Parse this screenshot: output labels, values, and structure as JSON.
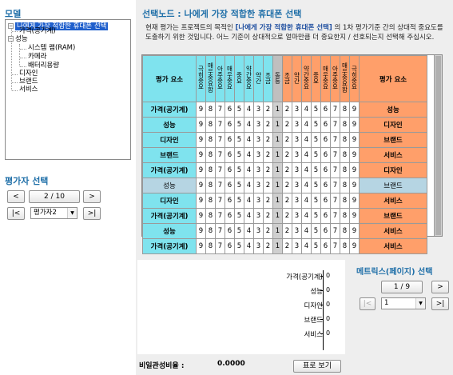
{
  "model": {
    "title": "모델",
    "tree": [
      {
        "label": "나에게 가장 적합한 휴대폰 선택",
        "selected": true
      },
      {
        "label": "가격(공기계)"
      },
      {
        "label": "성능"
      },
      {
        "label": "시스템 램(RAM)"
      },
      {
        "label": "카메라"
      },
      {
        "label": "배터리용량"
      },
      {
        "label": "디자인"
      },
      {
        "label": "브랜드"
      },
      {
        "label": "서비스"
      }
    ]
  },
  "evaluator": {
    "title": "평가자 선택",
    "prev": "<",
    "page": "2 / 10",
    "next": ">",
    "first": "|<",
    "selected": "평가자2",
    "last": ">|"
  },
  "selected_node": {
    "title": "선택노드 : 나에게 가장 적합한 휴대폰 선택",
    "desc_1": "현재 평가는 프로젝트의 목적인 ",
    "desc_goal": "[나에게 가장 적합한 휴대폰 선택]",
    "desc_2": " 의 1차 평가기준 간의 상대적 중요도를 도출하기 위한 것입니다. 어느 기준이 상대적으로 얼마만큼 더 중요한지 / 선호되는지 선택해 주십시오."
  },
  "grid": {
    "header_left": "평가 요소",
    "header_right": "평가 요소",
    "scale_left": [
      "극히중요",
      "매우중요함",
      "아주중요",
      "매우중요",
      "중요",
      "약간중요",
      "약간",
      "조금",
      "동등"
    ],
    "scale_mid": "동등",
    "scale_right": [
      "조금",
      "약간",
      "약간중요",
      "중요",
      "매우중요",
      "아주중요",
      "매우중요함",
      "극히중요"
    ],
    "numbers_left": [
      "9",
      "8",
      "7",
      "6",
      "5",
      "4",
      "3",
      "2"
    ],
    "number_mid": "1",
    "numbers_right": [
      "2",
      "3",
      "4",
      "5",
      "6",
      "7",
      "8",
      "9"
    ],
    "rows": [
      {
        "left": "가격(공기계)",
        "right": "성능"
      },
      {
        "left": "성능",
        "right": "디자인"
      },
      {
        "left": "디자인",
        "right": "브랜드"
      },
      {
        "left": "브랜드",
        "right": "서비스"
      },
      {
        "left": "가격(공기계)",
        "right": "디자인"
      },
      {
        "left": "성능",
        "right": "브랜드",
        "selected": true
      },
      {
        "left": "디자인",
        "right": "서비스"
      },
      {
        "left": "가격(공기계)",
        "right": "브랜드"
      },
      {
        "left": "성능",
        "right": "서비스"
      },
      {
        "left": "가격(공기계)",
        "right": "서비스"
      }
    ]
  },
  "chart_data": {
    "type": "bar",
    "categories": [
      "가격(공기계)",
      "성능",
      "디자인",
      "브랜드",
      "서비스"
    ],
    "values": [
      0,
      0,
      0,
      0,
      0
    ]
  },
  "inconsistency": {
    "label": "비일관성비율 :",
    "value": "0.0000"
  },
  "show_table_button": "표로 보기",
  "matrix": {
    "title": "메트릭스(페이지) 선택",
    "prev": "<",
    "page": "1 / 9",
    "next": ">",
    "first": "|<",
    "selected": "1",
    "last": ">|"
  }
}
